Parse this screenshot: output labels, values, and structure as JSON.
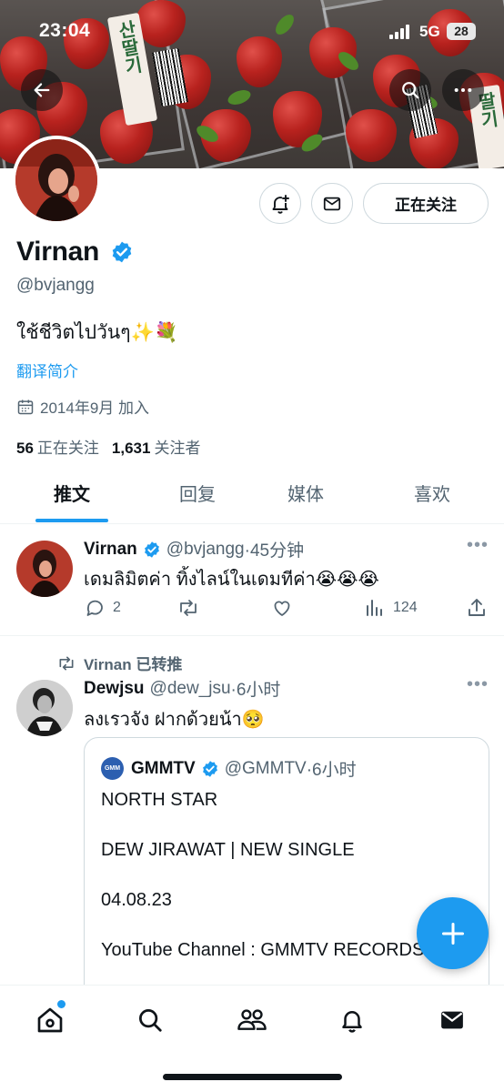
{
  "status_bar": {
    "time": "23:04",
    "network": "5G",
    "battery": "28"
  },
  "profile": {
    "name": "Virnan",
    "handle": "@bvjangg",
    "bio": "ใช้ชีวิตไปวันๆ✨💐",
    "translate_label": "翻译简介",
    "joined": "2014年9月 加入",
    "following_count": "56",
    "following_label": "正在关注",
    "followers_count": "1,631",
    "followers_label": "关注者",
    "follow_button_label": "正在关注",
    "verified": true
  },
  "tabs": [
    {
      "label": "推文",
      "active": true
    },
    {
      "label": "回复",
      "active": false
    },
    {
      "label": "媒体",
      "active": false
    },
    {
      "label": "喜欢",
      "active": false
    }
  ],
  "tweets": [
    {
      "name": "Virnan",
      "handle": "@bvjangg",
      "time": "·45分钟",
      "text": "เดมลิมิตค่า ทิ้งไลน์ในเดมทีค่า😭😭😭",
      "replies": "2",
      "views": "124"
    },
    {
      "retweeted_by": "Virnan 已转推",
      "name": "Dewjsu",
      "handle": "@dew_jsu",
      "time": "·6小时",
      "text": "ลงเรวจัง ฝากด้วยน้า🥺",
      "quote": {
        "logo_text": "GMM",
        "name": "GMMTV",
        "handle": "@GMMTV",
        "time": "·6小时",
        "lines": [
          "NORTH STAR",
          "DEW JIRAWAT | NEW SINGLE",
          "04.08.23",
          "YouTube Channel : GMMTV RECORDS"
        ]
      }
    }
  ],
  "colors": {
    "accent": "#1d9bf0",
    "text": "#0f1419",
    "muted": "#536471"
  },
  "icons": [
    "back-icon",
    "search-icon",
    "more-icon",
    "notification-bell-plus-icon",
    "mail-icon",
    "calendar-icon",
    "verified-badge-icon",
    "reply-icon",
    "retweet-icon",
    "like-icon",
    "views-icon",
    "share-icon",
    "compose-plus-icon",
    "home-icon",
    "explore-icon",
    "communities-icon",
    "notifications-icon",
    "messages-icon"
  ]
}
